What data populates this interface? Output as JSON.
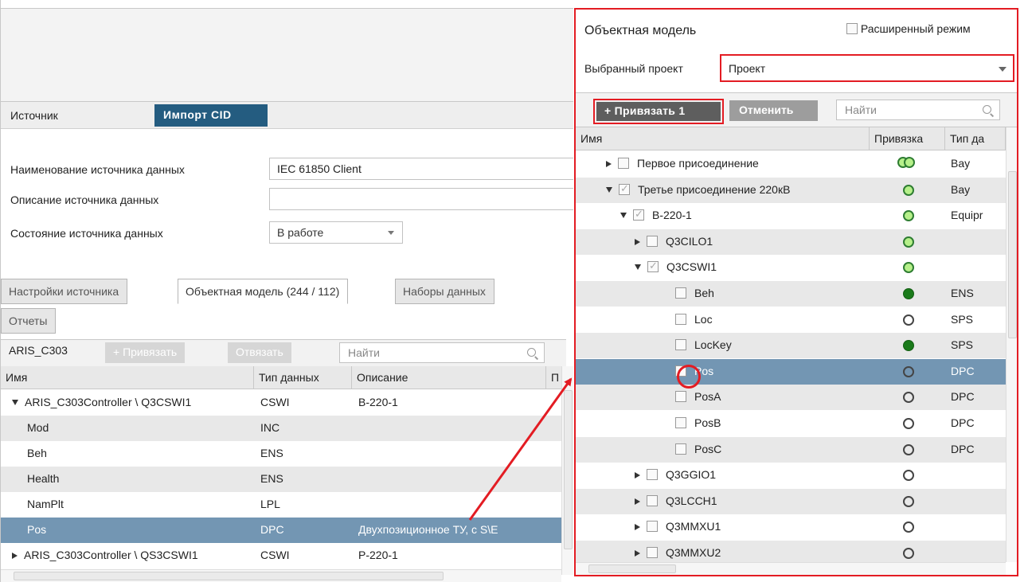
{
  "source_bar": {
    "label": "Источник",
    "import_button": "Импорт CID"
  },
  "form": {
    "name_label": "Наименование источника данных",
    "name_value": "IEC 61850 Client",
    "desc_label": "Описание источника данных",
    "desc_value": "",
    "state_label": "Состояние источника данных",
    "state_value": "В работе"
  },
  "tabs": [
    {
      "label": "Настройки источника"
    },
    {
      "label": "Объектная модель (244 / 112)"
    },
    {
      "label": "Наборы данных"
    },
    {
      "label": "Отчеты"
    }
  ],
  "left_toolbar": {
    "source_name": "ARIS_C303",
    "bind_button": "+ Привязать",
    "unbind_button": "Отвязать",
    "search_placeholder": "Найти"
  },
  "left_grid": {
    "columns": [
      "Имя",
      "Тип данных",
      "Описание",
      "П"
    ],
    "rows": [
      {
        "name": "ARIS_C303Controller \\ Q3CSWI1",
        "type": "CSWI",
        "desc": "B-220-1"
      },
      {
        "name": "Mod",
        "type": "INC",
        "desc": ""
      },
      {
        "name": "Beh",
        "type": "ENS",
        "desc": ""
      },
      {
        "name": "Health",
        "type": "ENS",
        "desc": ""
      },
      {
        "name": "NamPlt",
        "type": "LPL",
        "desc": ""
      },
      {
        "name": "Pos",
        "type": "DPC",
        "desc": "Двухпозиционное ТУ, с S\\E"
      },
      {
        "name": "ARIS_C303Controller \\ QS3CSWI1",
        "type": "CSWI",
        "desc": "P-220-1"
      }
    ]
  },
  "right_panel": {
    "title": "Объектная модель",
    "extended_mode": "Расширенный режим",
    "project_label": "Выбранный проект",
    "project_value": "Проект",
    "bind_button": "+ Привязать 1",
    "cancel_button": "Отменить",
    "search_placeholder": "Найти",
    "columns": [
      "Имя",
      "Привязка",
      "Тип да"
    ],
    "rows": [
      {
        "name": "Первое присоединение",
        "binding": "partial",
        "type": "Bay"
      },
      {
        "name": "Третье присоединение 220кВ",
        "binding": "light",
        "type": "Bay"
      },
      {
        "name": "B-220-1",
        "binding": "light",
        "type": "Equipr"
      },
      {
        "name": "Q3CILO1",
        "binding": "light",
        "type": ""
      },
      {
        "name": "Q3CSWI1",
        "binding": "light",
        "type": ""
      },
      {
        "name": "Beh",
        "binding": "dark",
        "type": "ENS"
      },
      {
        "name": "Loc",
        "binding": "empty",
        "type": "SPS"
      },
      {
        "name": "LocKey",
        "binding": "dark",
        "type": "SPS"
      },
      {
        "name": "Pos",
        "binding": "empty",
        "type": "DPC"
      },
      {
        "name": "PosA",
        "binding": "empty",
        "type": "DPC"
      },
      {
        "name": "PosB",
        "binding": "empty",
        "type": "DPC"
      },
      {
        "name": "PosC",
        "binding": "empty",
        "type": "DPC"
      },
      {
        "name": "Q3GGIO1",
        "binding": "empty",
        "type": ""
      },
      {
        "name": "Q3LCCH1",
        "binding": "empty",
        "type": ""
      },
      {
        "name": "Q3MMXU1",
        "binding": "empty",
        "type": ""
      },
      {
        "name": "Q3MMXU2",
        "binding": "empty",
        "type": ""
      }
    ]
  },
  "colors": {
    "accent_blue": "#245c80",
    "selection": "#7396b3",
    "highlight_red": "#e31c23",
    "bound_green": "#1a7a1a"
  }
}
